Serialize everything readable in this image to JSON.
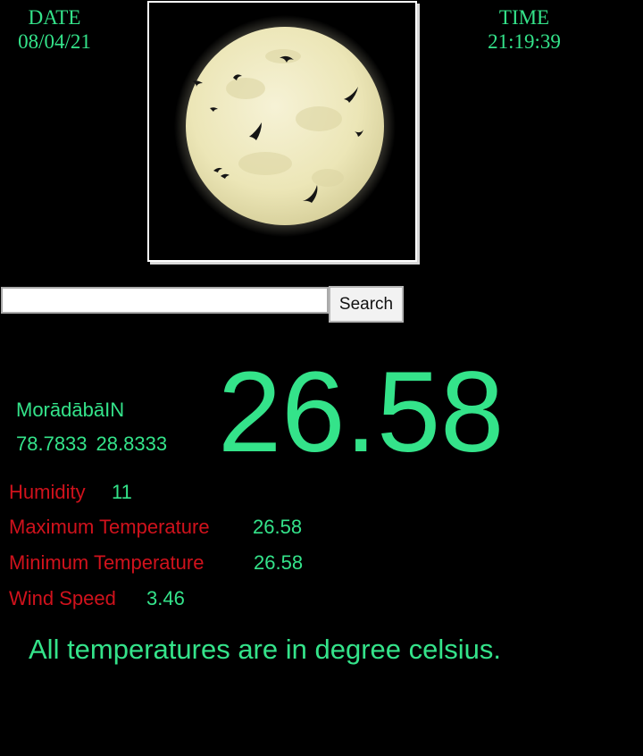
{
  "header": {
    "date_label": "DATE",
    "date_value": "08/04/21",
    "time_label": "TIME",
    "time_value": "21:19:39"
  },
  "image": {
    "icon": "moon-with-bats-icon",
    "frame_color": "#ffffff",
    "moon_color": "#f2eec8"
  },
  "search": {
    "value": "",
    "placeholder": "",
    "button_label": "Search"
  },
  "location": {
    "city": "Morādābā",
    "country": "IN",
    "lon": "78.7833",
    "lat": "28.8333"
  },
  "current_temperature": "26.58",
  "stats": {
    "humidity_label": "Humidity",
    "humidity_value": "11",
    "max_label": "Maximum Temperature",
    "max_value": "26.58",
    "min_label": "Minimum Temperature",
    "min_value": "26.58",
    "wind_label": "Wind Speed",
    "wind_value": "3.46"
  },
  "footer_note": "All temperatures are in degree celsius.",
  "colors": {
    "accent_green": "#34e38a",
    "label_red": "#d0121c",
    "background": "#000000"
  }
}
